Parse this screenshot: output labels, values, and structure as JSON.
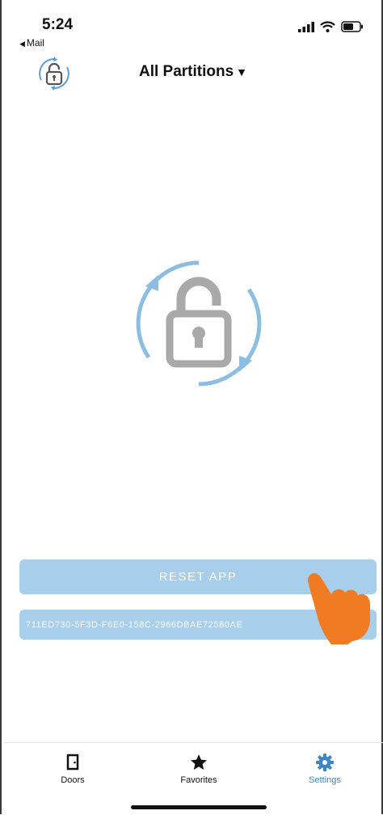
{
  "status_bar": {
    "time": "5:24",
    "back_label": "Mail",
    "back_icon": "back-triangle-icon",
    "icons": [
      "signal-icon",
      "wifi-icon",
      "battery-icon"
    ]
  },
  "header": {
    "title": "All Partitions",
    "dropdown_icon": "caret-down-icon",
    "logo_icon": "lock-refresh-icon"
  },
  "main": {
    "center_icon": "unlocked-lock-refresh-icon",
    "reset_button_label": "RESET APP",
    "device_id": "711ED730-5F3D-F6E0-158C-2966DBAE72580AE"
  },
  "tabs": [
    {
      "label": "Doors",
      "icon": "door-icon"
    },
    {
      "label": "Favorites",
      "icon": "star-icon"
    },
    {
      "label": "Settings",
      "icon": "gear-icon",
      "active": true
    }
  ],
  "colors": {
    "accent": "#3d87c6",
    "button_bg": "#a7cfeb",
    "ring": "#8cbde3",
    "lock_gray": "#a9a9a9",
    "hand": "#f07b22"
  }
}
